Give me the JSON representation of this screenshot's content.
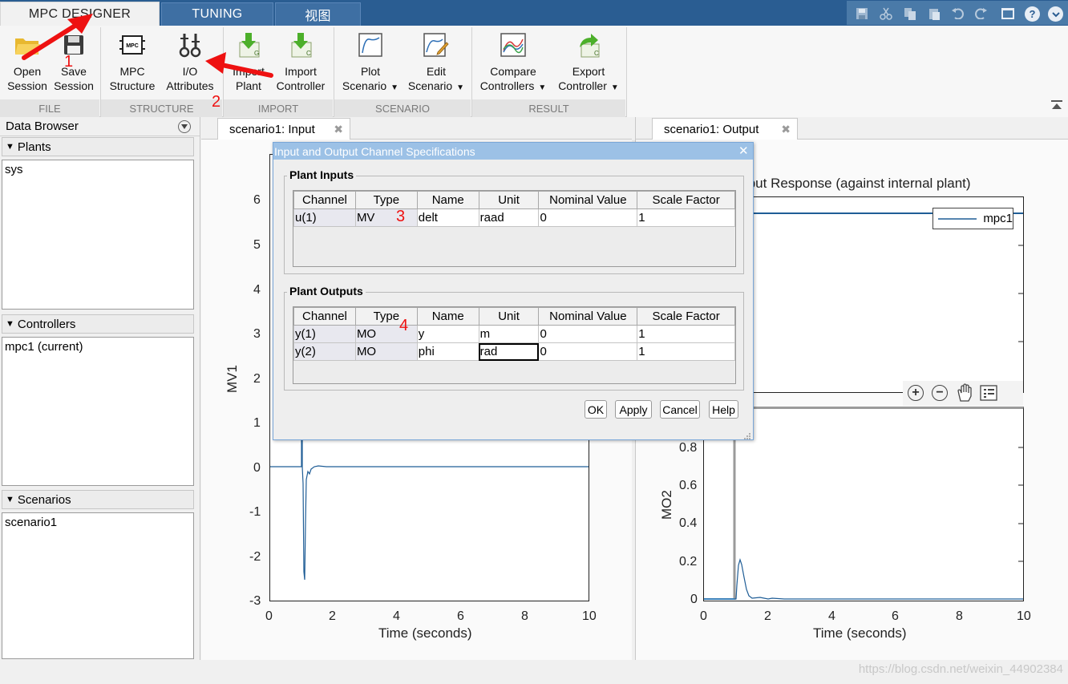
{
  "tabs": [
    {
      "label": "MPC DESIGNER",
      "active": true
    },
    {
      "label": "TUNING",
      "active": false
    },
    {
      "label": "视图",
      "active": false
    }
  ],
  "quick_access": [
    "save-icon",
    "cut-icon",
    "copy-icon",
    "paste-icon",
    "undo-icon",
    "redo-icon",
    "window-icon",
    "help-icon",
    "expand-icon"
  ],
  "ribbon": {
    "file": {
      "label": "FILE",
      "open_session": {
        "line1": "Open",
        "line2": "Session"
      },
      "save_session": {
        "line1": "Save",
        "line2": "Session"
      }
    },
    "structure": {
      "label": "STRUCTURE",
      "mpc_structure": {
        "line1": "MPC",
        "line2": "Structure"
      },
      "io_attributes": {
        "line1": "I/O",
        "line2": "Attributes"
      }
    },
    "import": {
      "label": "IMPORT",
      "import_plant": {
        "line1": "Import",
        "line2": "Plant"
      },
      "import_controller": {
        "line1": "Import",
        "line2": "Controller"
      }
    },
    "scenario": {
      "label": "SCENARIO",
      "plot_scenario": {
        "line1": "Plot",
        "line2": "Scenario"
      },
      "edit_scenario": {
        "line1": "Edit",
        "line2": "Scenario"
      }
    },
    "result": {
      "label": "RESULT",
      "compare_controllers": {
        "line1": "Compare",
        "line2": "Controllers"
      },
      "export_controller": {
        "line1": "Export",
        "line2": "Controller"
      }
    },
    "icon_mpc_text": "MPC"
  },
  "data_browser": {
    "title": "Data Browser",
    "plants": {
      "label": "Plants",
      "items": [
        "sys"
      ]
    },
    "controllers": {
      "label": "Controllers",
      "items": [
        "mpc1 (current)"
      ]
    },
    "scenarios": {
      "label": "Scenarios",
      "items": [
        "scenario1"
      ]
    }
  },
  "doc_tabs": {
    "input": "scenario1: Input",
    "output": "scenario1: Output"
  },
  "input_plot": {
    "ylabel": "MV1",
    "xlabel": "Time (seconds)",
    "yticks": [
      "6",
      "5",
      "4",
      "3",
      "2",
      "1",
      "0",
      "-1",
      "-2",
      "-3"
    ],
    "xticks": [
      "0",
      "2",
      "4",
      "6",
      "8",
      "10"
    ]
  },
  "output_plot": {
    "title_fragment": "tput Response (against internal plant)",
    "legend": "mpc1",
    "ylabel": "MO2",
    "xlabel": "Time (seconds)",
    "yticks": [
      "0.8",
      "0.6",
      "0.4",
      "0.2",
      "0"
    ],
    "xticks": [
      "0",
      "2",
      "4",
      "6",
      "8",
      "10"
    ]
  },
  "dialog": {
    "title": "Input and Output Channel Specifications",
    "columns": [
      "Channel",
      "Type",
      "Name",
      "Unit",
      "Nominal Value",
      "Scale Factor"
    ],
    "plant_inputs": {
      "label": "Plant Inputs",
      "rows": [
        [
          "u(1)",
          "MV",
          "delt",
          "raad",
          "0",
          "1"
        ]
      ]
    },
    "plant_outputs": {
      "label": "Plant Outputs",
      "rows": [
        [
          "y(1)",
          "MO",
          "y",
          "m",
          "0",
          "1"
        ],
        [
          "y(2)",
          "MO",
          "phi",
          "rad",
          "0",
          "1"
        ]
      ]
    },
    "buttons": {
      "ok": "OK",
      "apply": "Apply",
      "cancel": "Cancel",
      "help": "Help"
    }
  },
  "annotations": [
    "1",
    "2",
    "3",
    "4"
  ],
  "watermark": "https://blog.csdn.net/weixin_44902384",
  "colors": {
    "titlebar": "#2a5d92",
    "dialog_title": "#9cc1e6",
    "series": "#1f5d96",
    "annotation": "#ee1111"
  }
}
